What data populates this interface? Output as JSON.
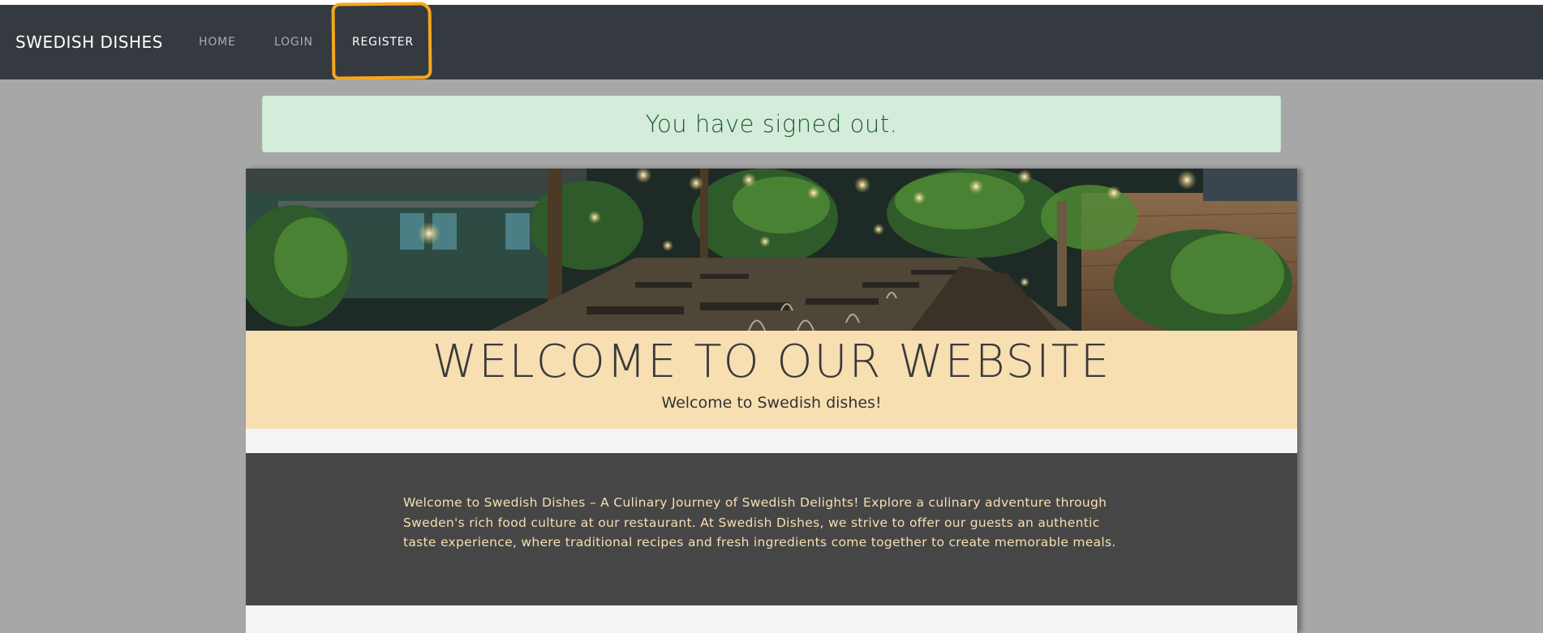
{
  "navbar": {
    "brand": "SWEDISH DISHES",
    "links": [
      {
        "label": "HOME",
        "active": false
      },
      {
        "label": "LOGIN",
        "active": false
      },
      {
        "label": "REGISTER",
        "active": true
      }
    ]
  },
  "alert": {
    "message": "You have signed out."
  },
  "hero": {
    "image": "restaurant-terrace-photo"
  },
  "welcome": {
    "title": "WELCOME TO OUR WEBSITE",
    "subtitle": "Welcome to Swedish dishes!"
  },
  "intro": {
    "text": "Welcome to Swedish Dishes – A Culinary Journey of Swedish Delights! Explore a culinary adventure through Sweden's rich food culture at our restaurant. At Swedish Dishes, we strive to offer our guests an authentic taste experience, where traditional recipes and fresh ingredients come together to create memorable meals."
  },
  "colors": {
    "navbar": "#343a40",
    "alert_bg": "#d4eddb",
    "alert_text": "#1f5a2d",
    "welcome_band": "#f7dfb2",
    "dark_section": "#464646",
    "highlight": "#f4a81d"
  }
}
